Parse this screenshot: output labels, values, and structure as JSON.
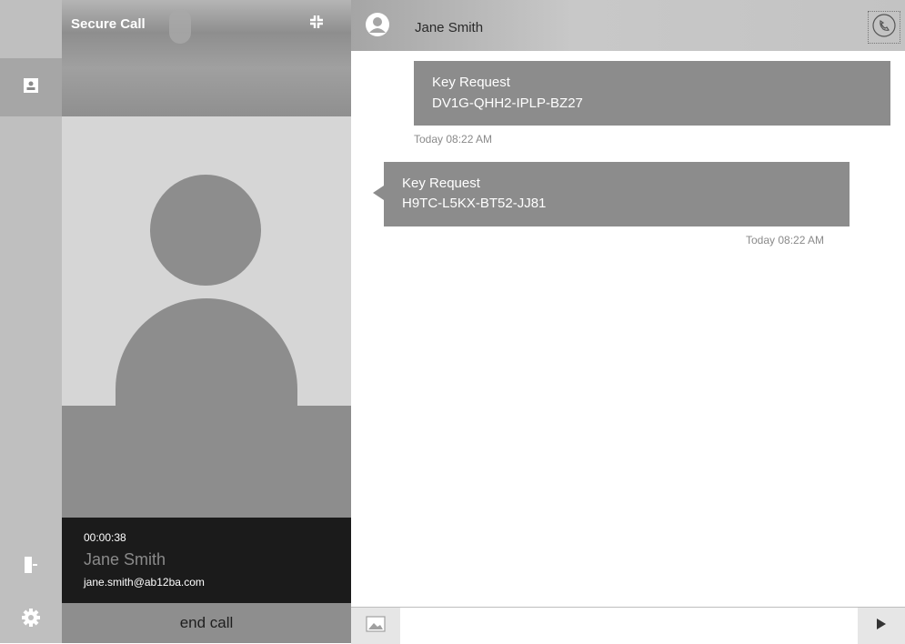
{
  "rail": {
    "items": [
      {
        "icon": "chat-bubbles-icon"
      },
      {
        "icon": "contacts-icon"
      },
      {
        "icon": "exit-door-icon"
      },
      {
        "icon": "gear-icon"
      }
    ]
  },
  "call": {
    "title": "Secure Call",
    "minimize_icon": "minimize-arrows-icon",
    "timer": "00:00:38",
    "name": "Jane Smith",
    "email": "jane.smith@ab12ba.com",
    "end_label": "end call"
  },
  "chat": {
    "contact_name": "Jane Smith",
    "call_icon": "phone-icon",
    "messages": [
      {
        "direction": "outgoing",
        "title": "Key Request",
        "key": "DV1G-QHH2-IPLP-BZ27",
        "time": "Today 08:22 AM"
      },
      {
        "direction": "incoming",
        "title": "Key Request",
        "key": "H9TC-L5KX-BT52-JJ81",
        "time": "Today 08:22 AM"
      }
    ],
    "composer": {
      "placeholder": "",
      "image_icon": "image-icon",
      "send_icon": "send-arrow-icon"
    }
  },
  "colors": {
    "bubble": "#8c8c8c",
    "call_info_bg": "#1b1b1b",
    "end_call_bg": "#8e8e8e"
  }
}
